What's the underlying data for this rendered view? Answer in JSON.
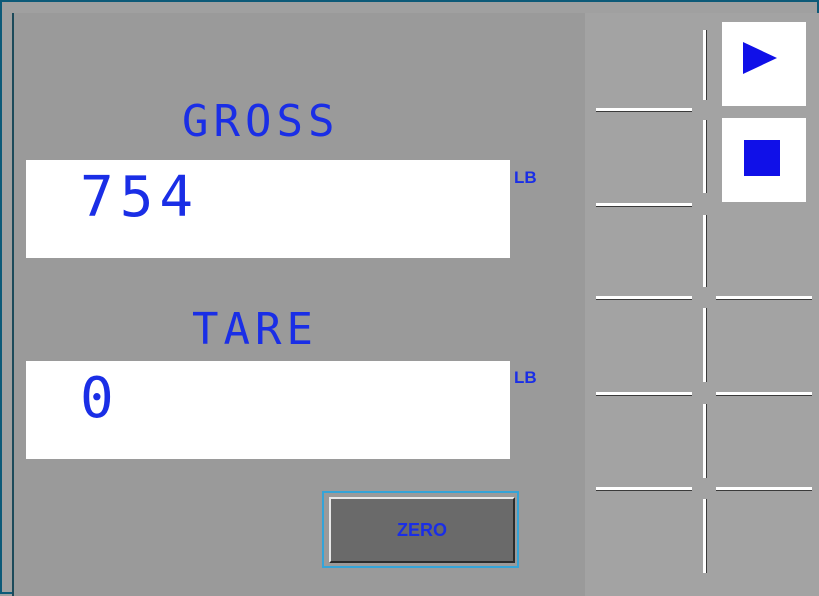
{
  "gross": {
    "label": "GROSS",
    "value": "754",
    "unit": "LB"
  },
  "tare": {
    "label": "TARE",
    "value": "0",
    "unit": "LB"
  },
  "buttons": {
    "zero_label": "ZERO"
  },
  "icons": {
    "play": "play-icon",
    "stop": "stop-icon"
  },
  "colors": {
    "text_blue": "#1a2ee6",
    "icon_blue": "#1010e8",
    "panel_gray": "#9a9a9a",
    "frame_teal": "#0d5a78"
  }
}
